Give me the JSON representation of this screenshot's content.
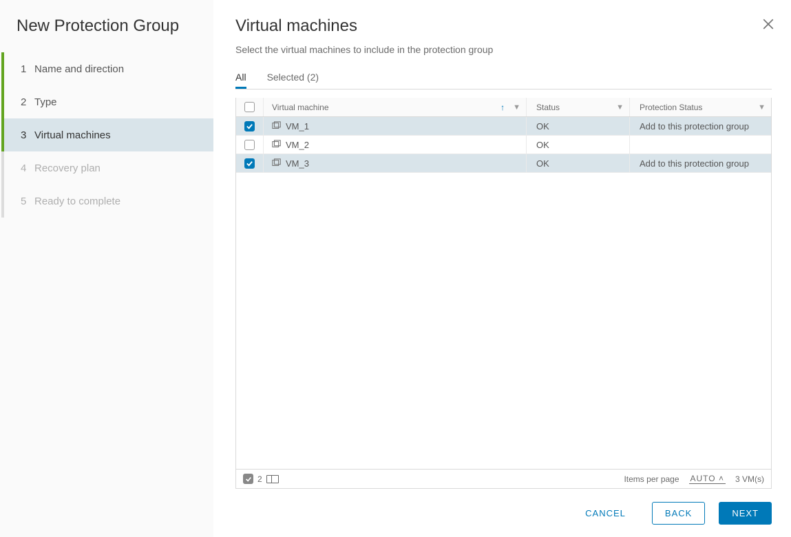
{
  "sidebar": {
    "title": "New Protection Group",
    "steps": [
      {
        "num": "1",
        "label": "Name and direction"
      },
      {
        "num": "2",
        "label": "Type"
      },
      {
        "num": "3",
        "label": "Virtual machines"
      },
      {
        "num": "4",
        "label": "Recovery plan"
      },
      {
        "num": "5",
        "label": "Ready to complete"
      }
    ]
  },
  "main": {
    "title": "Virtual machines",
    "subtitle": "Select the virtual machines to include in the protection group",
    "tabs": {
      "all": "All",
      "selected": "Selected (2)"
    },
    "columns": {
      "vm": "Virtual machine",
      "status": "Status",
      "protection": "Protection Status"
    },
    "rows": [
      {
        "name": "VM_1",
        "status": "OK",
        "protection": "Add to this protection group",
        "checked": true
      },
      {
        "name": "VM_2",
        "status": "OK",
        "protection": "",
        "checked": false
      },
      {
        "name": "VM_3",
        "status": "OK",
        "protection": "Add to this protection group",
        "checked": true
      }
    ],
    "footer": {
      "selected_count": "2",
      "items_per_page_label": "Items per page",
      "items_per_page_value": "AUTO",
      "total": "3 VM(s)"
    }
  },
  "buttons": {
    "cancel": "CANCEL",
    "back": "BACK",
    "next": "NEXT"
  }
}
